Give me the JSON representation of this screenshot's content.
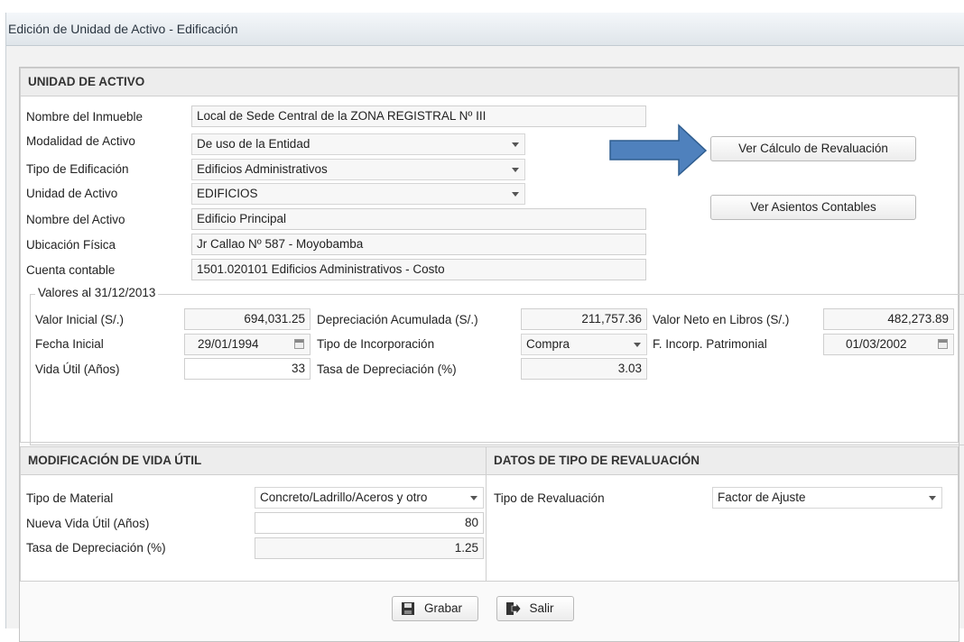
{
  "window": {
    "title": "Edición de Unidad de Activo - Edificación"
  },
  "unidad": {
    "header": "UNIDAD DE ACTIVO",
    "nombre_inmueble": {
      "label": "Nombre del Inmueble",
      "value": "Local de Sede Central de la ZONA REGISTRAL Nº III"
    },
    "modalidad": {
      "label": "Modalidad de Activo",
      "value": "De uso de la Entidad"
    },
    "tipo_edificacion": {
      "label": "Tipo de Edificación",
      "value": "Edificios Administrativos"
    },
    "unidad_activo": {
      "label": "Unidad de Activo",
      "value": "EDIFICIOS"
    },
    "nombre_activo": {
      "label": "Nombre del Activo",
      "value": "Edificio Principal"
    },
    "ubicacion": {
      "label": "Ubicación Física",
      "value": "Jr Callao Nº 587 - Moyobamba"
    },
    "cuenta": {
      "label": "Cuenta contable",
      "value": "1501.020101 Edificios Administrativos - Costo"
    },
    "btn_calculo": "Ver Cálculo de Revaluación",
    "btn_asientos": "Ver Asientos Contables",
    "arrow_color": "#4f81bd"
  },
  "valores": {
    "legend": "Valores al 31/12/2013",
    "valor_inicial": {
      "label": "Valor Inicial (S/.)",
      "value": "694,031.25"
    },
    "dep_acumulada": {
      "label": "Depreciación Acumulada (S/.)",
      "value": "211,757.36"
    },
    "valor_neto": {
      "label": "Valor Neto en Libros (S/.)",
      "value": "482,273.89"
    },
    "fecha_inicial": {
      "label": "Fecha Inicial",
      "value": "29/01/1994"
    },
    "tipo_incorp": {
      "label": "Tipo de Incorporación",
      "value": "Compra"
    },
    "f_incorp": {
      "label": "F. Incorp. Patrimonial",
      "value": "01/03/2002"
    },
    "vida_util": {
      "label": "Vida Útil (Años)",
      "value": "33"
    },
    "tasa_dep": {
      "label": "Tasa de Depreciación (%)",
      "value": "3.03"
    }
  },
  "modificacion": {
    "header": "MODIFICACIÓN DE VIDA ÚTIL",
    "tipo_material": {
      "label": "Tipo de Material",
      "value": "Concreto/Ladrillo/Aceros y otro"
    },
    "nueva_vida": {
      "label": "Nueva Vida Útil (Años)",
      "value": "80"
    },
    "tasa": {
      "label": "Tasa de Depreciación (%)",
      "value": "1.25"
    }
  },
  "revaluacion": {
    "header": "DATOS DE TIPO DE REVALUACIÓN",
    "tipo": {
      "label": "Tipo de Revaluación",
      "value": "Factor de Ajuste"
    }
  },
  "footer": {
    "grabar": "Grabar",
    "salir": "Salir"
  }
}
